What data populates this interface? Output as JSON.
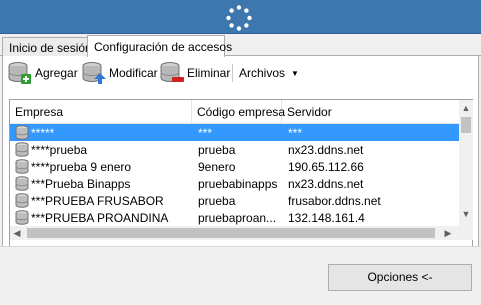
{
  "tabs": [
    {
      "label": "Inicio de sesión"
    },
    {
      "label": "Configuración de accesos"
    }
  ],
  "toolbar": {
    "add_label": "Agregar",
    "modify_label": "Modificar",
    "delete_label": "Eliminar",
    "files_label": "Archivos",
    "files_caret": "▼"
  },
  "grid": {
    "columns": [
      "Empresa",
      "Código empresa",
      "Servidor"
    ],
    "rows": [
      {
        "name": "*****",
        "code": "***",
        "server": "***",
        "selected": true
      },
      {
        "name": "****prueba",
        "code": "prueba",
        "server": "nx23.ddns.net"
      },
      {
        "name": "****prueba 9 enero",
        "code": "9enero",
        "server": "190.65.112.66"
      },
      {
        "name": "***Prueba Binapps",
        "code": "pruebabinapps",
        "server": "nx23.ddns.net"
      },
      {
        "name": "***PRUEBA FRUSABOR",
        "code": "prueba",
        "server": "frusabor.ddns.net"
      },
      {
        "name": "***PRUEBA PROANDINA",
        "code": "pruebaproan...",
        "server": "132.148.161.4"
      }
    ]
  },
  "footer": {
    "options_label": "Opciones <-"
  },
  "colors": {
    "titlebar": "#3d77ad",
    "selection": "#3399ff"
  },
  "icons": {
    "titlebar": "loading-spinner-icon",
    "add": "database-add-icon",
    "modify": "database-edit-icon",
    "delete": "database-remove-icon",
    "row": "database-icon"
  }
}
